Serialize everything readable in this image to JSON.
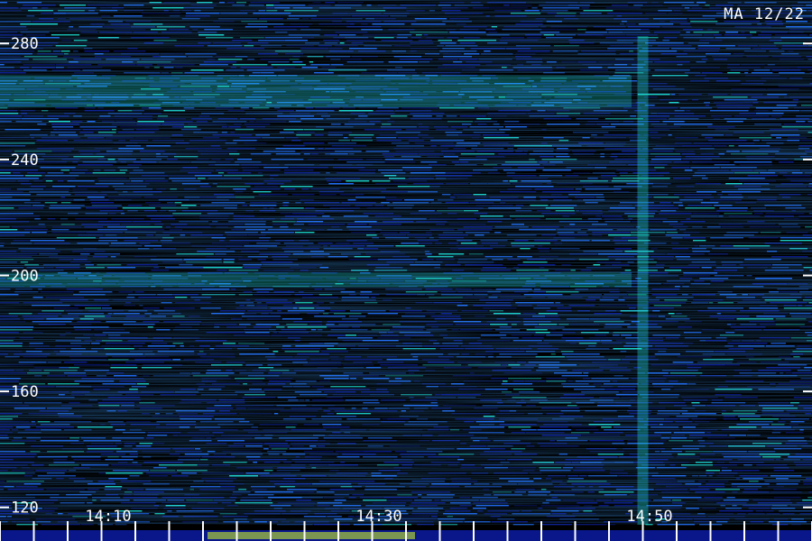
{
  "station_label": "MA 12/22",
  "chart_data": {
    "type": "heatmap",
    "title": "",
    "xlabel": "",
    "ylabel": "",
    "x_ticks": [
      "14:10",
      "14:30",
      "14:50"
    ],
    "x_tick_minutes": [
      10,
      30,
      50
    ],
    "x_range_minutes": [
      2,
      62
    ],
    "y_ticks": [
      120,
      160,
      200,
      240,
      280
    ],
    "y_range": [
      114,
      295
    ],
    "colors": {
      "background": "#000000",
      "low": "#0a1a9a",
      "mid": "#1e6cff",
      "high": "#19e6d2",
      "peak": "#d8ff20",
      "axis": "#ffffff"
    },
    "bands": [
      {
        "name": "busy-band",
        "y_from": 258,
        "y_to": 269
      },
      {
        "name": "busy-band-2",
        "y_from": 196,
        "y_to": 201
      }
    ],
    "events": [
      {
        "name": "vertical-streak",
        "x_minute": 49.5
      }
    ]
  }
}
